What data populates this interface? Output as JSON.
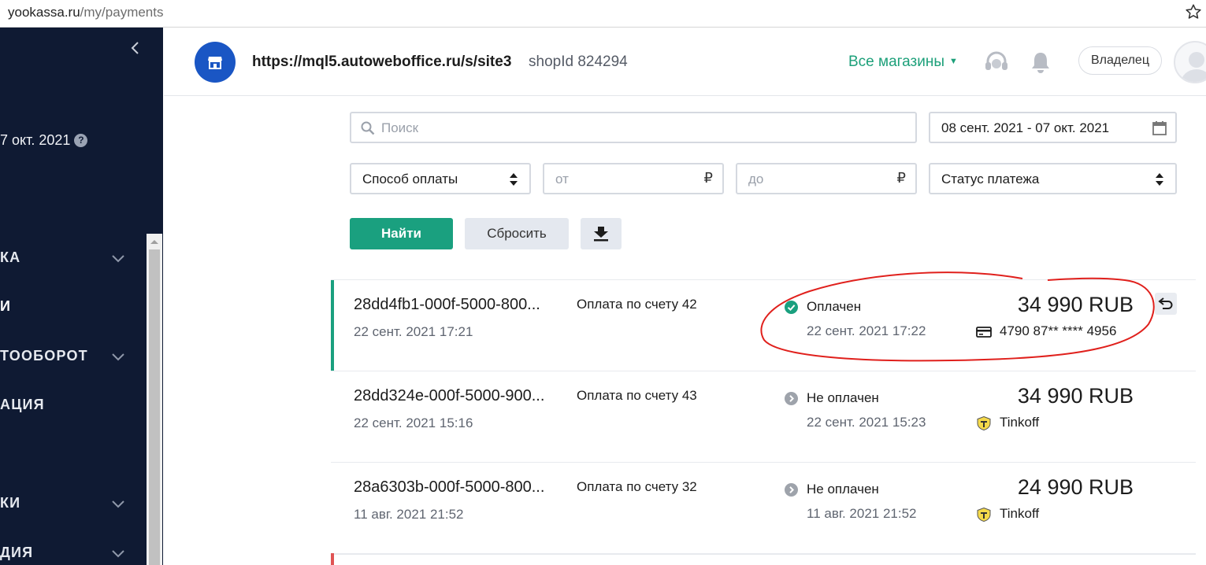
{
  "browser": {
    "url_host": "yookassa.ru",
    "url_path": "/my/payments",
    "bookmark_icon": "star-icon"
  },
  "sidebar": {
    "collapse_icon": "chevron-left-icon",
    "date_range": "7 окт. 2021",
    "help_icon": "question-circle-icon",
    "items": [
      {
        "label": "КА",
        "expandable": true
      },
      {
        "label": "И",
        "expandable": false
      },
      {
        "label": "ТООБОРОТ",
        "expandable": true
      },
      {
        "label": "АЦИЯ",
        "expandable": false
      },
      {
        "label": "КИ",
        "expandable": true
      },
      {
        "label": "ДИЯ",
        "expandable": true
      }
    ]
  },
  "header": {
    "shop_icon": "store-icon",
    "shop_url": "https://mql5.autoweboffice.ru/s/site3",
    "shop_id": "shopId 824294",
    "all_shops_label": "Все магазины",
    "support_icon": "headset-icon",
    "notifications_icon": "bell-icon",
    "owner_label": "Владелец",
    "accent_color": "#1da07a"
  },
  "filters": {
    "search_placeholder": "Поиск",
    "date_range": "08 сент. 2021 - 07 окт. 2021",
    "payment_method_label": "Способ оплаты",
    "amount_from_placeholder": "от",
    "amount_to_placeholder": "до",
    "currency_symbol": "₽",
    "status_label": "Статус платежа",
    "find_button": "Найти",
    "reset_button": "Сбросить",
    "download_icon": "download-icon"
  },
  "payments": [
    {
      "id": "28dd4fb1-000f-5000-800...",
      "created": "22 сент. 2021 17:21",
      "description": "Оплата по счету 42",
      "status": "Оплачен",
      "status_date": "22 сент. 2021 17:22",
      "amount": "34 990 RUB",
      "method": "4790 87** **** 4956",
      "method_icon": "credit-card-icon",
      "status_color": "#1aa07f",
      "refund_icon": "undo-icon"
    },
    {
      "id": "28dd324e-000f-5000-900...",
      "created": "22 сент. 2021 15:16",
      "description": "Оплата по счету 43",
      "status": "Не оплачен",
      "status_date": "22 сент. 2021 15:23",
      "amount": "34 990 RUB",
      "method": "Tinkoff",
      "method_icon": "tinkoff-icon",
      "status_color": "#9ea3ab"
    },
    {
      "id": "28a6303b-000f-5000-800...",
      "created": "11 авг. 2021 21:52",
      "description": "Оплата по счету 32",
      "status": "Не оплачен",
      "status_date": "11 авг. 2021 21:52",
      "amount": "24 990 RUB",
      "method": "Tinkoff",
      "method_icon": "tinkoff-icon",
      "status_color": "#9ea3ab"
    }
  ]
}
